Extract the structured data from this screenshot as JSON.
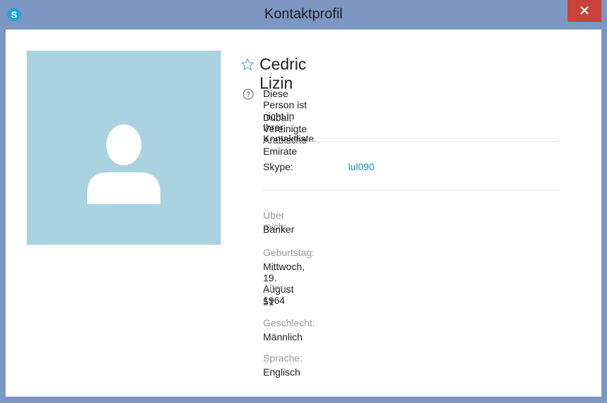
{
  "window": {
    "title": "Kontaktprofil",
    "app_icon": "skype-logo-icon",
    "close_glyph": "✕",
    "colors": {
      "titlebar": "#7b97c2",
      "close": "#c7433a",
      "avatar_bg": "#aad3e1",
      "link": "#1c8fc7"
    }
  },
  "profile": {
    "name": "Cedric Lizin",
    "favorite_icon": "star-outline-icon",
    "status_icon": "question-circle-icon",
    "not_in_list": "Diese Person ist nicht in Ihrer Kontaktliste.",
    "location": "Dubai, Vereinigte Arabische Emirate",
    "skype_label": "Skype:",
    "skype_id": "lul090",
    "fields": [
      {
        "label": "Über mich:",
        "value": "Banker"
      },
      {
        "label": "Geburtstag:",
        "value": "Mittwoch, 19. August 1964"
      },
      {
        "label": "Alter:",
        "value": "51"
      },
      {
        "label": "Geschlecht:",
        "value": "Männlich"
      },
      {
        "label": "Sprache:",
        "value": "Englisch"
      }
    ]
  }
}
